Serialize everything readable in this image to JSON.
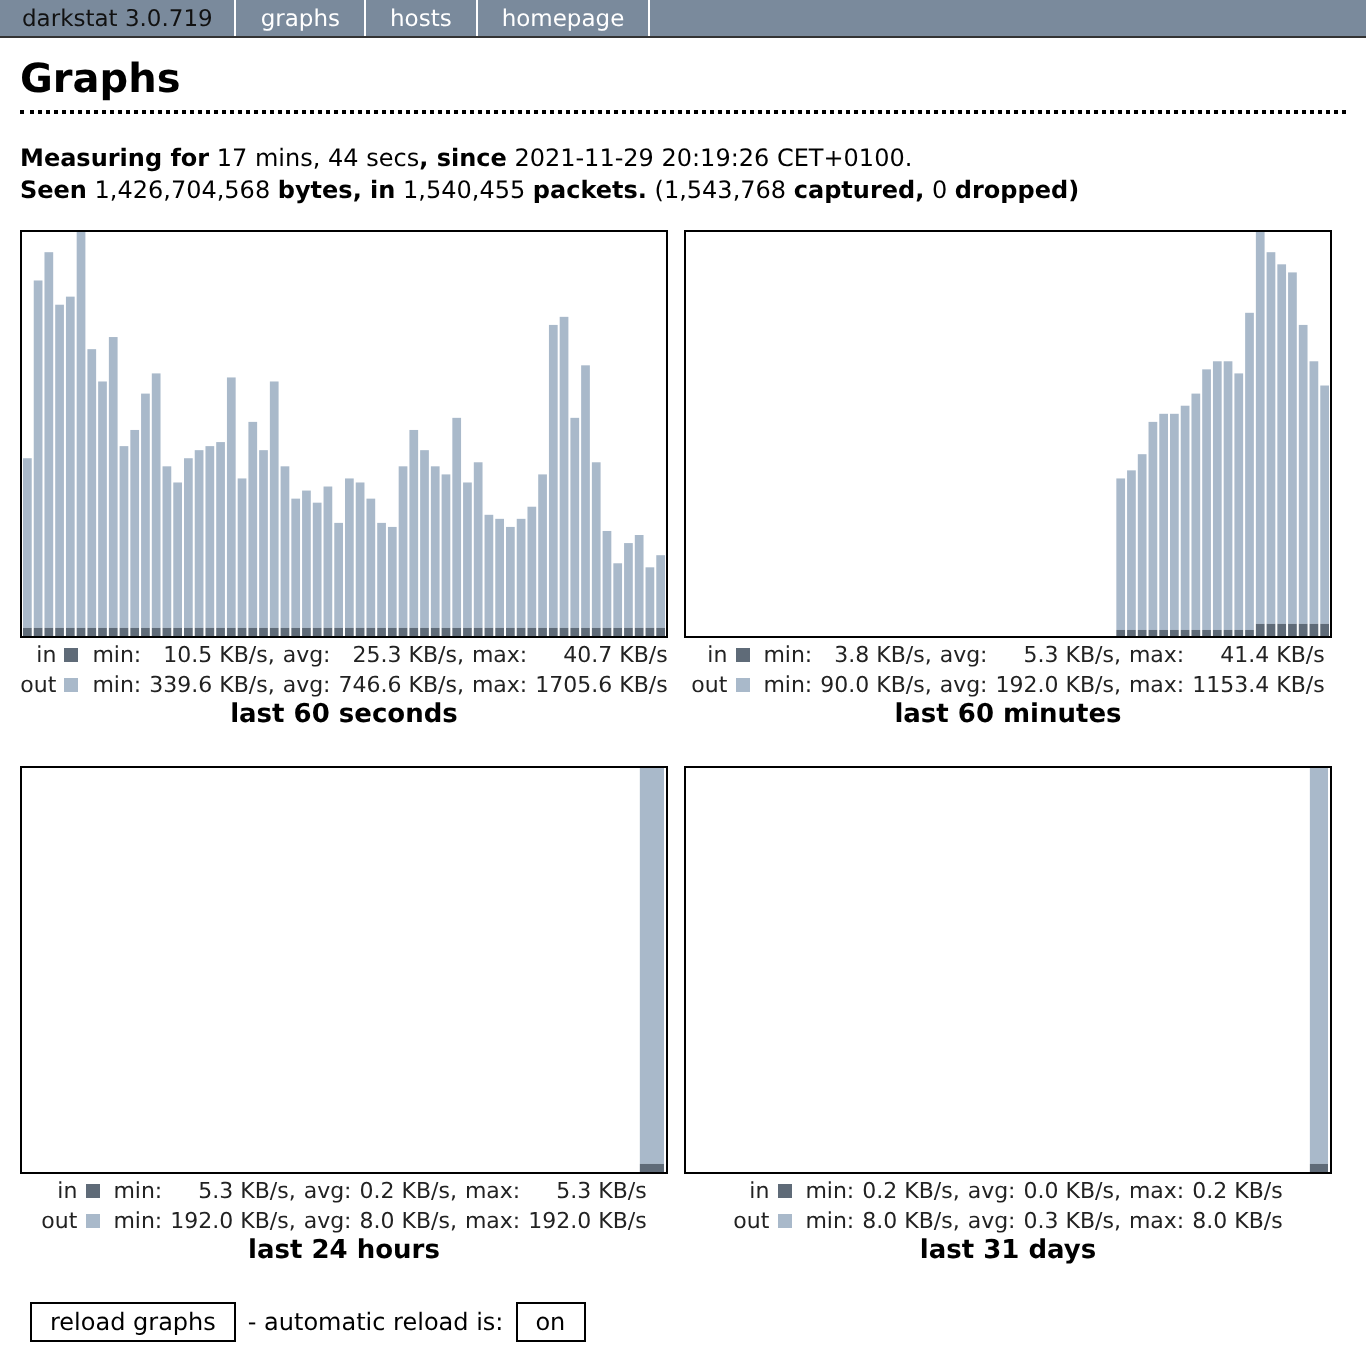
{
  "navbar": {
    "title": "darkstat 3.0.719",
    "links": [
      "graphs",
      "hosts",
      "homepage"
    ]
  },
  "heading": "Graphs",
  "summary": [
    "**Measuring for** 17 mins, 44 secs**, since** 2021-11-29 20:19:26 CET+0100.",
    "**Seen** 1,426,704,568 **bytes, in** 1,540,455 **packets.** (1,543,768 **captured,** 0 **dropped)**"
  ],
  "graphs": [
    {
      "kind": "picture",
      "caption": "last 60 seconds",
      "stats": [
        {
          "label": "in",
          "color": "#5f6b78",
          "cells": [
            "min:",
            "10.5 KB/s,",
            "avg:",
            "25.3 KB/s,",
            "max:",
            "40.7 KB/s"
          ]
        },
        {
          "label": "out",
          "color": "#a9b9ca",
          "cells": [
            "min:",
            "339.6 KB/s,",
            "avg:",
            "746.6 KB/s,",
            "max:",
            "1705.6 KB/s"
          ]
        }
      ]
    },
    {
      "kind": "picture",
      "caption": "last 60 minutes",
      "stats": [
        {
          "label": "in",
          "color": "#5f6b78",
          "cells": [
            "min:",
            "3.8 KB/s,",
            "avg:",
            "5.3 KB/s,",
            "max:",
            "41.4 KB/s"
          ]
        },
        {
          "label": "out",
          "color": "#a9b9ca",
          "cells": [
            "min:",
            "90.0 KB/s,",
            "avg:",
            "192.0 KB/s,",
            "max:",
            "1153.4 KB/s"
          ]
        }
      ]
    },
    {
      "kind": "picture",
      "caption": "last 24 hours",
      "stats": [
        {
          "label": "in",
          "color": "#5f6b78",
          "cells": [
            "min:",
            "5.3 KB/s,",
            "avg:",
            "0.2 KB/s,",
            "max:",
            "5.3 KB/s"
          ]
        },
        {
          "label": "out",
          "color": "#a9b9ca",
          "cells": [
            "min:",
            "192.0 KB/s,",
            "avg:",
            "8.0 KB/s,",
            "max:",
            "192.0 KB/s"
          ]
        }
      ]
    },
    {
      "kind": "picture",
      "caption": "last 31 days",
      "stats": [
        {
          "label": "in",
          "color": "#5f6b78",
          "cells": [
            "min:",
            "0.2 KB/s,",
            "avg:",
            "0.0 KB/s,",
            "max:",
            "0.2 KB/s"
          ]
        },
        {
          "label": "out",
          "color": "#a9b9ca",
          "cells": [
            "min:",
            "8.0 KB/s,",
            "avg:",
            "0.3 KB/s,",
            "max:",
            "8.0 KB/s"
          ]
        }
      ]
    }
  ],
  "reload": {
    "button": "reload graphs",
    "text": "- automatic reload is:",
    "toggle": "on"
  }
}
